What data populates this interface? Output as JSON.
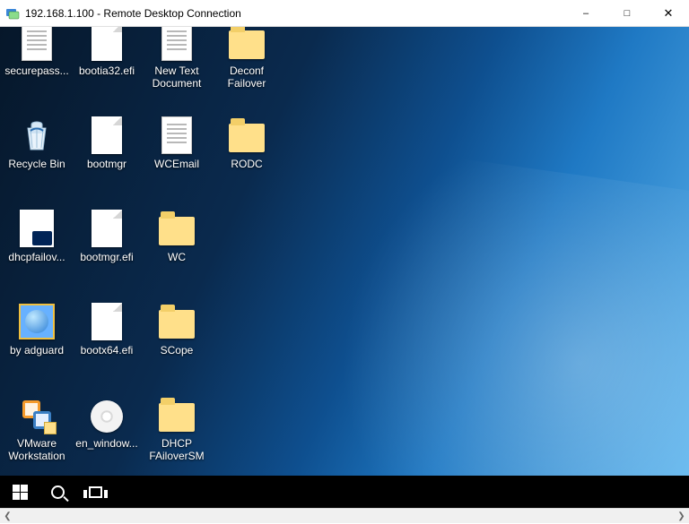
{
  "window": {
    "title": "192.168.1.100 - Remote Desktop Connection"
  },
  "desktop": {
    "icons": [
      {
        "label": "securepass...",
        "kind": "textdoc"
      },
      {
        "label": "bootia32.efi",
        "kind": "blankfile"
      },
      {
        "label": "New Text\nDocument",
        "kind": "textdoc"
      },
      {
        "label": "Deconf\nFailover",
        "kind": "folder"
      },
      {
        "label": "Recycle Bin",
        "kind": "recycle"
      },
      {
        "label": "bootmgr",
        "kind": "blankfile"
      },
      {
        "label": "WCEmail",
        "kind": "textdoc"
      },
      {
        "label": "RODC",
        "kind": "folder"
      },
      {
        "label": "dhcpfailov...",
        "kind": "ps1"
      },
      {
        "label": "bootmgr.efi",
        "kind": "blankfile"
      },
      {
        "label": "WC",
        "kind": "folder"
      },
      {
        "label": "",
        "kind": "empty"
      },
      {
        "label": "by adguard",
        "kind": "html"
      },
      {
        "label": "bootx64.efi",
        "kind": "blankfile"
      },
      {
        "label": "SCope",
        "kind": "folder"
      },
      {
        "label": "",
        "kind": "empty"
      },
      {
        "label": "VMware\nWorkstation",
        "kind": "vmware"
      },
      {
        "label": "en_window...",
        "kind": "disc"
      },
      {
        "label": "DHCP\nFAiloverSM",
        "kind": "folder"
      },
      {
        "label": "",
        "kind": "empty"
      }
    ]
  }
}
